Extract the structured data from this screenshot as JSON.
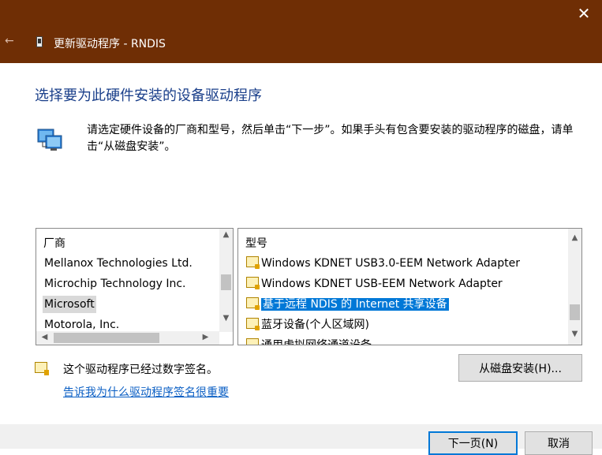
{
  "window": {
    "title": "更新驱动程序 - RNDIS",
    "close_glyph": "✕",
    "back_glyph": "←"
  },
  "heading": "选择要为此硬件安装的设备驱动程序",
  "description": "请选定硬件设备的厂商和型号，然后单击“下一步”。如果手头有包含要安装的驱动程序的磁盘，请单击“从磁盘安装”。",
  "manufacturer_list": {
    "header": "厂商",
    "items": [
      "Mellanox Technologies Ltd.",
      "Microchip Technology Inc.",
      "Microsoft",
      "Motorola, Inc."
    ],
    "selected_index": 2
  },
  "model_list": {
    "header": "型号",
    "items": [
      "Windows KDNET USB3.0-EEM Network Adapter",
      "Windows KDNET USB-EEM Network Adapter",
      "基于远程 NDIS 的 Internet 共享设备",
      "蓝牙设备(个人区域网)",
      "通用虚拟网络通道设备"
    ],
    "selected_index": 2
  },
  "signature": {
    "text": "这个驱动程序已经过数字签名。",
    "link": "告诉我为什么驱动程序签名很重要"
  },
  "buttons": {
    "have_disk": "从磁盘安装(H)...",
    "next": "下一页(N)",
    "cancel": "取消"
  },
  "colors": {
    "titlebar": "#6f2e05",
    "heading": "#1a3f8a",
    "selection": "#0078d7",
    "link": "#0b5fc4"
  }
}
